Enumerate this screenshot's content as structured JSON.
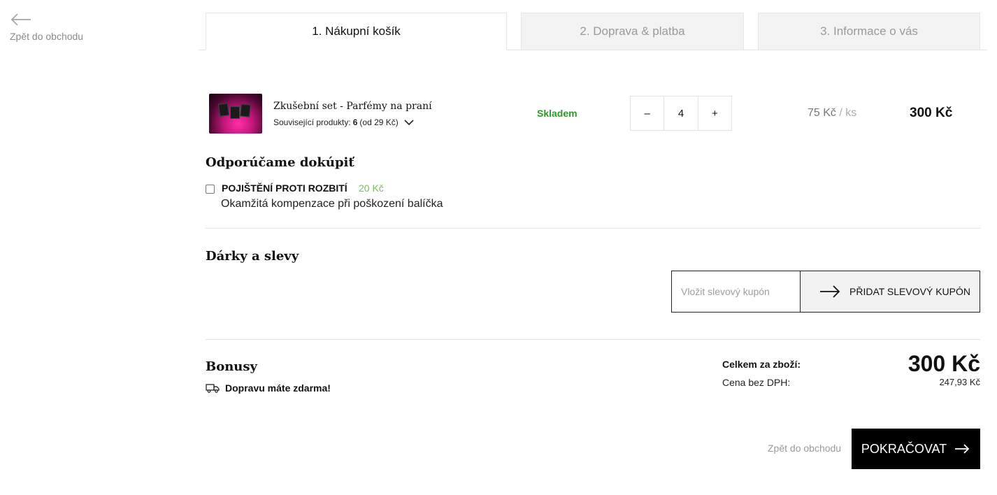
{
  "nav": {
    "back_label": "Zpět do obchodu"
  },
  "steps": [
    {
      "label": "1. Nákupní košík",
      "active": true
    },
    {
      "label": "2. Doprava & platba",
      "active": false
    },
    {
      "label": "3. Informace o vás",
      "active": false
    }
  ],
  "cart_item": {
    "name": "Zkušební set - Parfémy na praní",
    "related_label": "Související produkty:",
    "related_count": "6",
    "related_price": "(od 29 Kč)",
    "stock": "Skladem",
    "quantity": "4",
    "qty_minus": "–",
    "qty_plus": "+",
    "unit_price": "75 Kč",
    "unit_suffix": "/ ks",
    "total": "300 Kč"
  },
  "recommend": {
    "title": "Odporúčame dokúpiť",
    "insurance_name": "POJIŠTĚNÍ PROTI ROZBITÍ",
    "insurance_price": "20 Kč",
    "insurance_desc": "Okamžitá kompenzace při poškození balíčka"
  },
  "gifts": {
    "title": "Dárky a slevy",
    "coupon_placeholder": "Vložit slevový kupón",
    "coupon_button": "PŘIDAT SLEVOVÝ KUPÓN"
  },
  "bonus": {
    "title": "Bonusy",
    "free_shipping": "Dopravu máte zdarma!"
  },
  "totals": {
    "total_label": "Celkem za zboží:",
    "total_value": "300 Kč",
    "net_label": "Cena bez DPH:",
    "net_value": "247,93 Kč"
  },
  "footer": {
    "back_label": "Zpět do obchodu",
    "continue_label": "POKRAČOVAT"
  },
  "colors": {
    "stock_green": "#2b9a2b",
    "insurance_price_green": "#7dbb5a",
    "primary_button": "#000000"
  },
  "icons": [
    "arrow-left-icon",
    "chevron-down-icon",
    "arrow-right-icon",
    "truck-icon"
  ]
}
